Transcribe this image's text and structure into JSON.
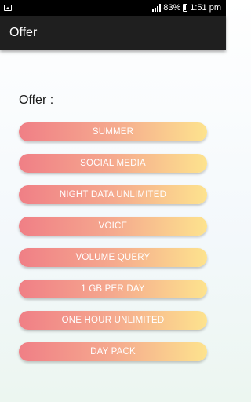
{
  "status_bar": {
    "battery": "83%",
    "time": "1:51 pm"
  },
  "app_bar": {
    "title": "Offer"
  },
  "content": {
    "label": "Offer :",
    "offers": [
      {
        "label": "SUMMER"
      },
      {
        "label": "SOCIAL MEDIA"
      },
      {
        "label": "NIGHT DATA UNLIMITED"
      },
      {
        "label": "VOICE"
      },
      {
        "label": "VOLUME QUERY"
      },
      {
        "label": "1 GB PER DAY"
      },
      {
        "label": "ONE HOUR UNLIMITED"
      },
      {
        "label": "DAY PACK"
      }
    ]
  },
  "colors": {
    "button_gradient_start": "#f07f86",
    "button_gradient_end": "#fde38e",
    "app_bar": "#1f1f1f"
  }
}
